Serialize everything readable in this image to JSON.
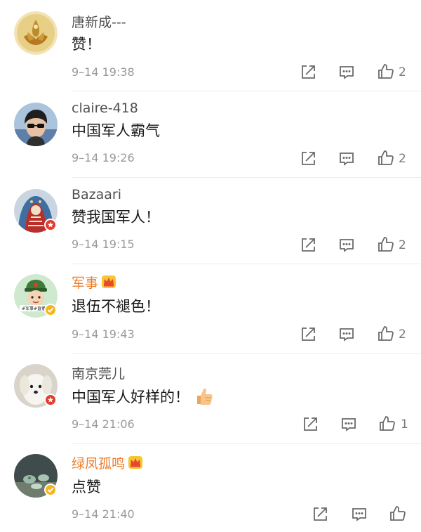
{
  "comments": [
    {
      "username": "唐新成---",
      "content": "赞！",
      "time": "9–14 19:38",
      "likes": "2"
    },
    {
      "username": "claire-418",
      "content": "中国军人霸气",
      "time": "9–14 19:26",
      "likes": "2"
    },
    {
      "username": "Bazaari",
      "content": "赞我国军人！",
      "time": "9–14 19:15",
      "likes": "2"
    },
    {
      "username": "军事",
      "content": "退伍不褪色！",
      "time": "9–14 19:43",
      "likes": "2",
      "avatar_text": "#军事#直播厅"
    },
    {
      "username": "南京莞儿",
      "content": "中国军人好样的！",
      "time": "9–14 21:06",
      "likes": "1"
    },
    {
      "username": "绿凤孤鸣",
      "content": "点赞",
      "time": "9–14 21:40",
      "likes": ""
    }
  ],
  "colors": {
    "vip_name": "#ee7d2a",
    "red_badge": "#e63a2e",
    "gold_badge": "#f5b51c"
  }
}
